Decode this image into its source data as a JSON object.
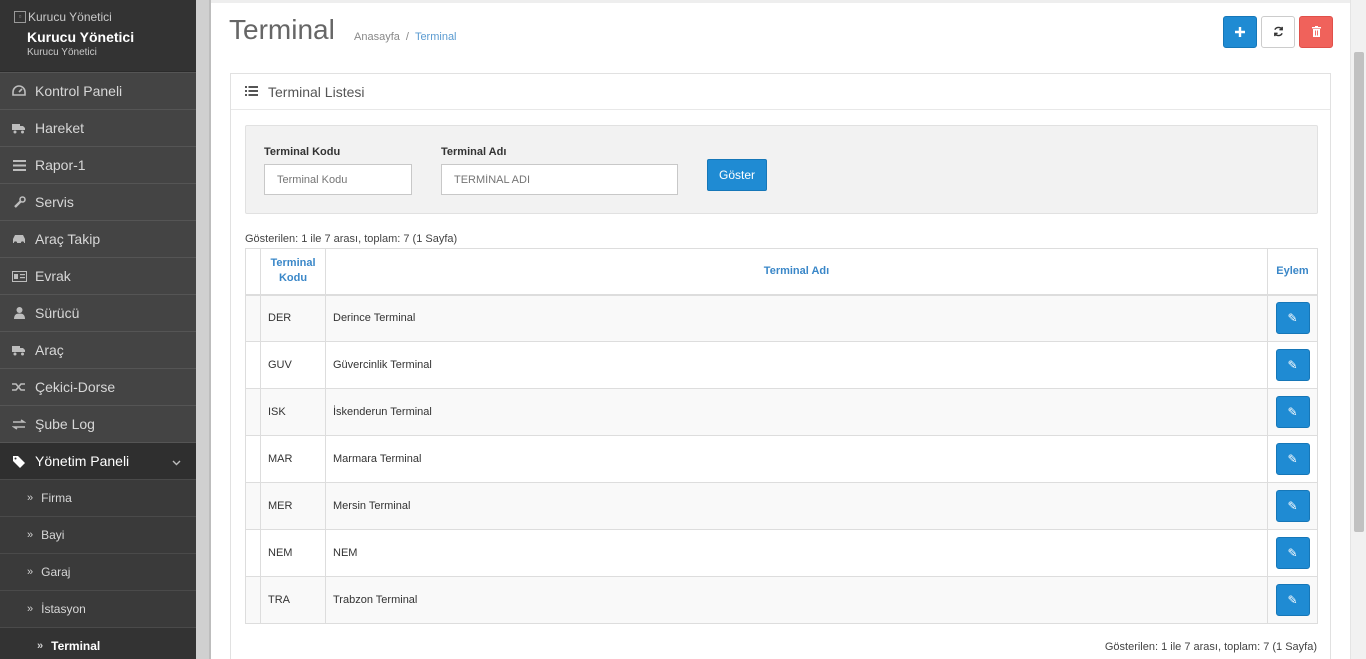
{
  "profile": {
    "image_alt": "Kurucu Yönetici",
    "name": "Kurucu Yönetici",
    "role": "Kurucu Yönetici"
  },
  "menu": [
    {
      "label": "Kontrol Paneli",
      "icon": "dashboard-icon"
    },
    {
      "label": "Hareket",
      "icon": "truck-icon"
    },
    {
      "label": "Rapor-1",
      "icon": "list-icon"
    },
    {
      "label": "Servis",
      "icon": "wrench-icon"
    },
    {
      "label": "Araç Takip",
      "icon": "car-icon"
    },
    {
      "label": "Evrak",
      "icon": "id-card-icon"
    },
    {
      "label": "Sürücü",
      "icon": "user-icon"
    },
    {
      "label": "Araç",
      "icon": "truck-icon"
    },
    {
      "label": "Çekici-Dorse",
      "icon": "random-icon"
    },
    {
      "label": "Şube Log",
      "icon": "exchange-icon"
    },
    {
      "label": "Yönetim Paneli",
      "icon": "tags-icon"
    }
  ],
  "submenu": [
    {
      "label": "Firma"
    },
    {
      "label": "Bayi"
    },
    {
      "label": "Garaj"
    },
    {
      "label": "İstasyon"
    },
    {
      "label": "Terminal"
    }
  ],
  "header": {
    "title": "Terminal",
    "breadcrumb_home": "Anasayfa",
    "breadcrumb_sep": "/",
    "breadcrumb_current": "Terminal"
  },
  "portlet": {
    "title": "Terminal Listesi"
  },
  "filter": {
    "code_label": "Terminal Kodu",
    "code_placeholder": "Terminal Kodu",
    "name_label": "Terminal Adı",
    "name_placeholder": "TERMİNAL ADI",
    "show_button": "Göster"
  },
  "summary": "Gösterilen: 1 ile 7 arası, toplam: 7 (1 Sayfa)",
  "table": {
    "headers": {
      "code_line1": "Terminal",
      "code_line2": "Kodu",
      "name": "Terminal Adı",
      "action": "Eylem"
    },
    "rows": [
      {
        "code": "DER",
        "name": "Derince Terminal"
      },
      {
        "code": "GUV",
        "name": "Güvercinlik Terminal"
      },
      {
        "code": "ISK",
        "name": "İskenderun Terminal"
      },
      {
        "code": "MAR",
        "name": "Marmara Terminal"
      },
      {
        "code": "MER",
        "name": "Mersin Terminal"
      },
      {
        "code": "NEM",
        "name": "NEM"
      },
      {
        "code": "TRA",
        "name": "Trabzon Terminal"
      }
    ]
  },
  "colors": {
    "primary": "#1f8bd3",
    "danger": "#f0625b",
    "sidebar": "#3d3d3d",
    "link": "#3a87c8"
  }
}
